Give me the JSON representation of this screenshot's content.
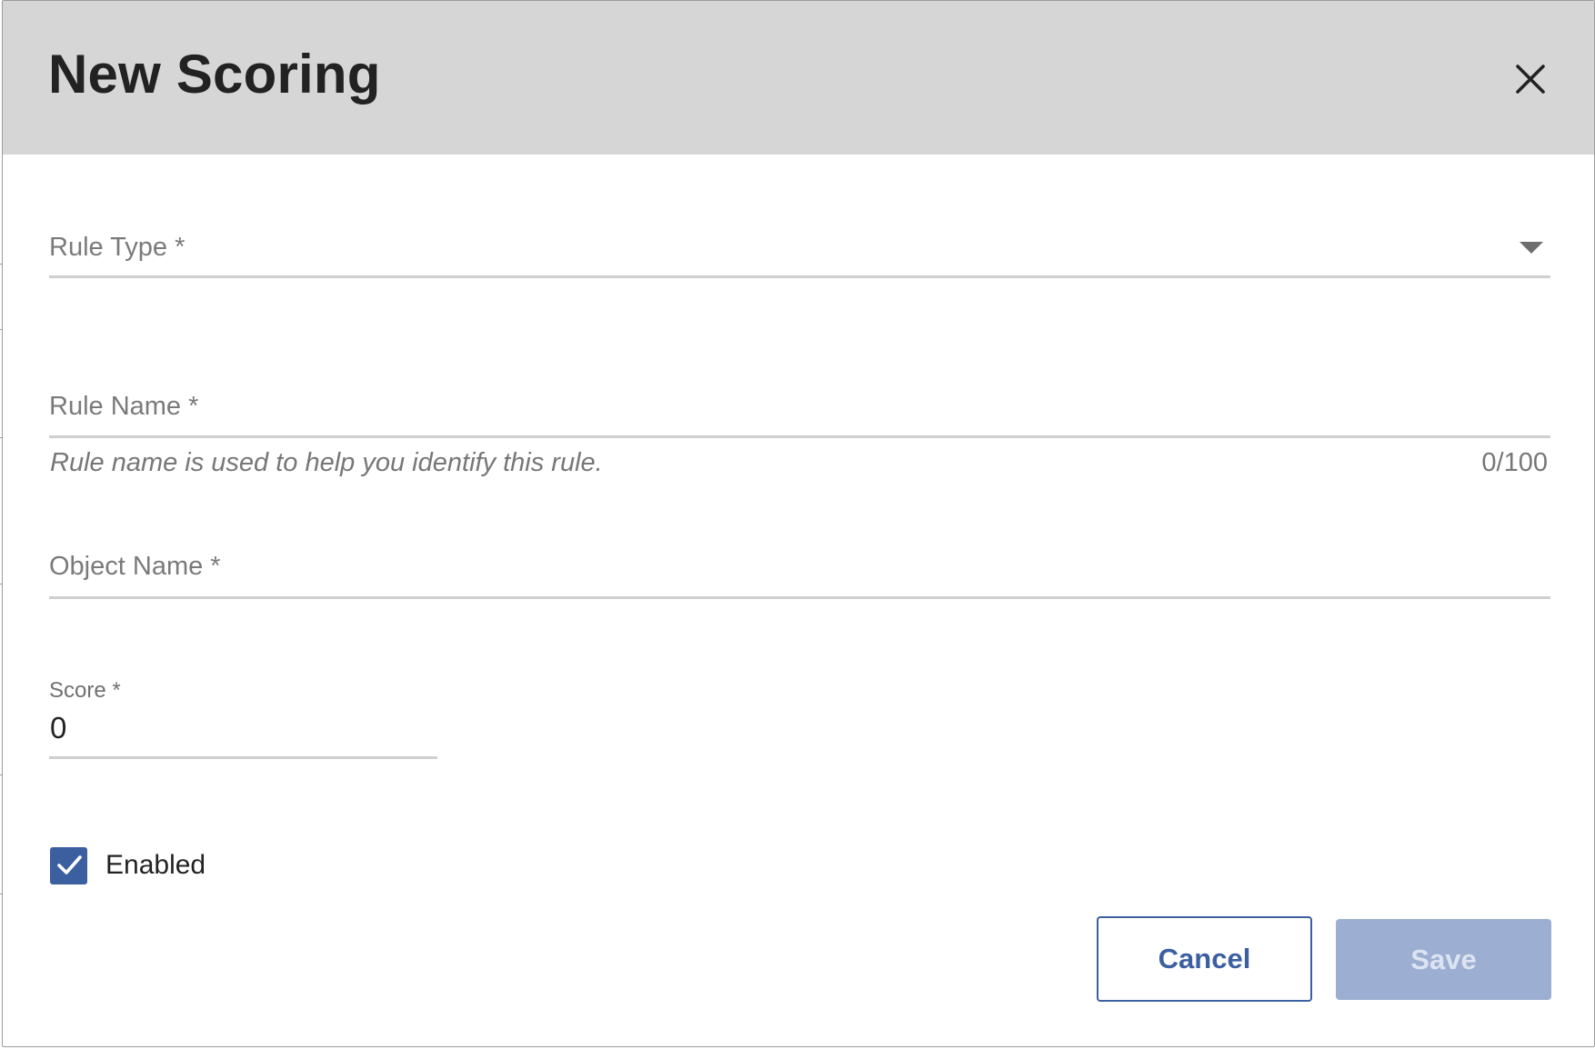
{
  "dialog": {
    "title": "New Scoring",
    "close_label": "Close"
  },
  "form": {
    "rule_type": {
      "label": "Rule Type *",
      "value": ""
    },
    "rule_name": {
      "label": "Rule Name *",
      "value": "",
      "helper": "Rule name is used to help you identify this rule.",
      "counter": "0/100"
    },
    "object_name": {
      "label": "Object Name *",
      "value": ""
    },
    "score": {
      "label": "Score *",
      "value": "0"
    },
    "enabled": {
      "label": "Enabled",
      "checked": true
    }
  },
  "actions": {
    "cancel_label": "Cancel",
    "save_label": "Save",
    "save_disabled": true
  },
  "colors": {
    "header_bg": "#d6d6d6",
    "accent": "#3c5fa0",
    "save_disabled_bg": "#9cafd2",
    "field_underline": "#cfcfcf"
  },
  "icons": {
    "close": "close-icon",
    "dropdown": "caret-down-icon",
    "checkmark": "checkmark-icon"
  }
}
